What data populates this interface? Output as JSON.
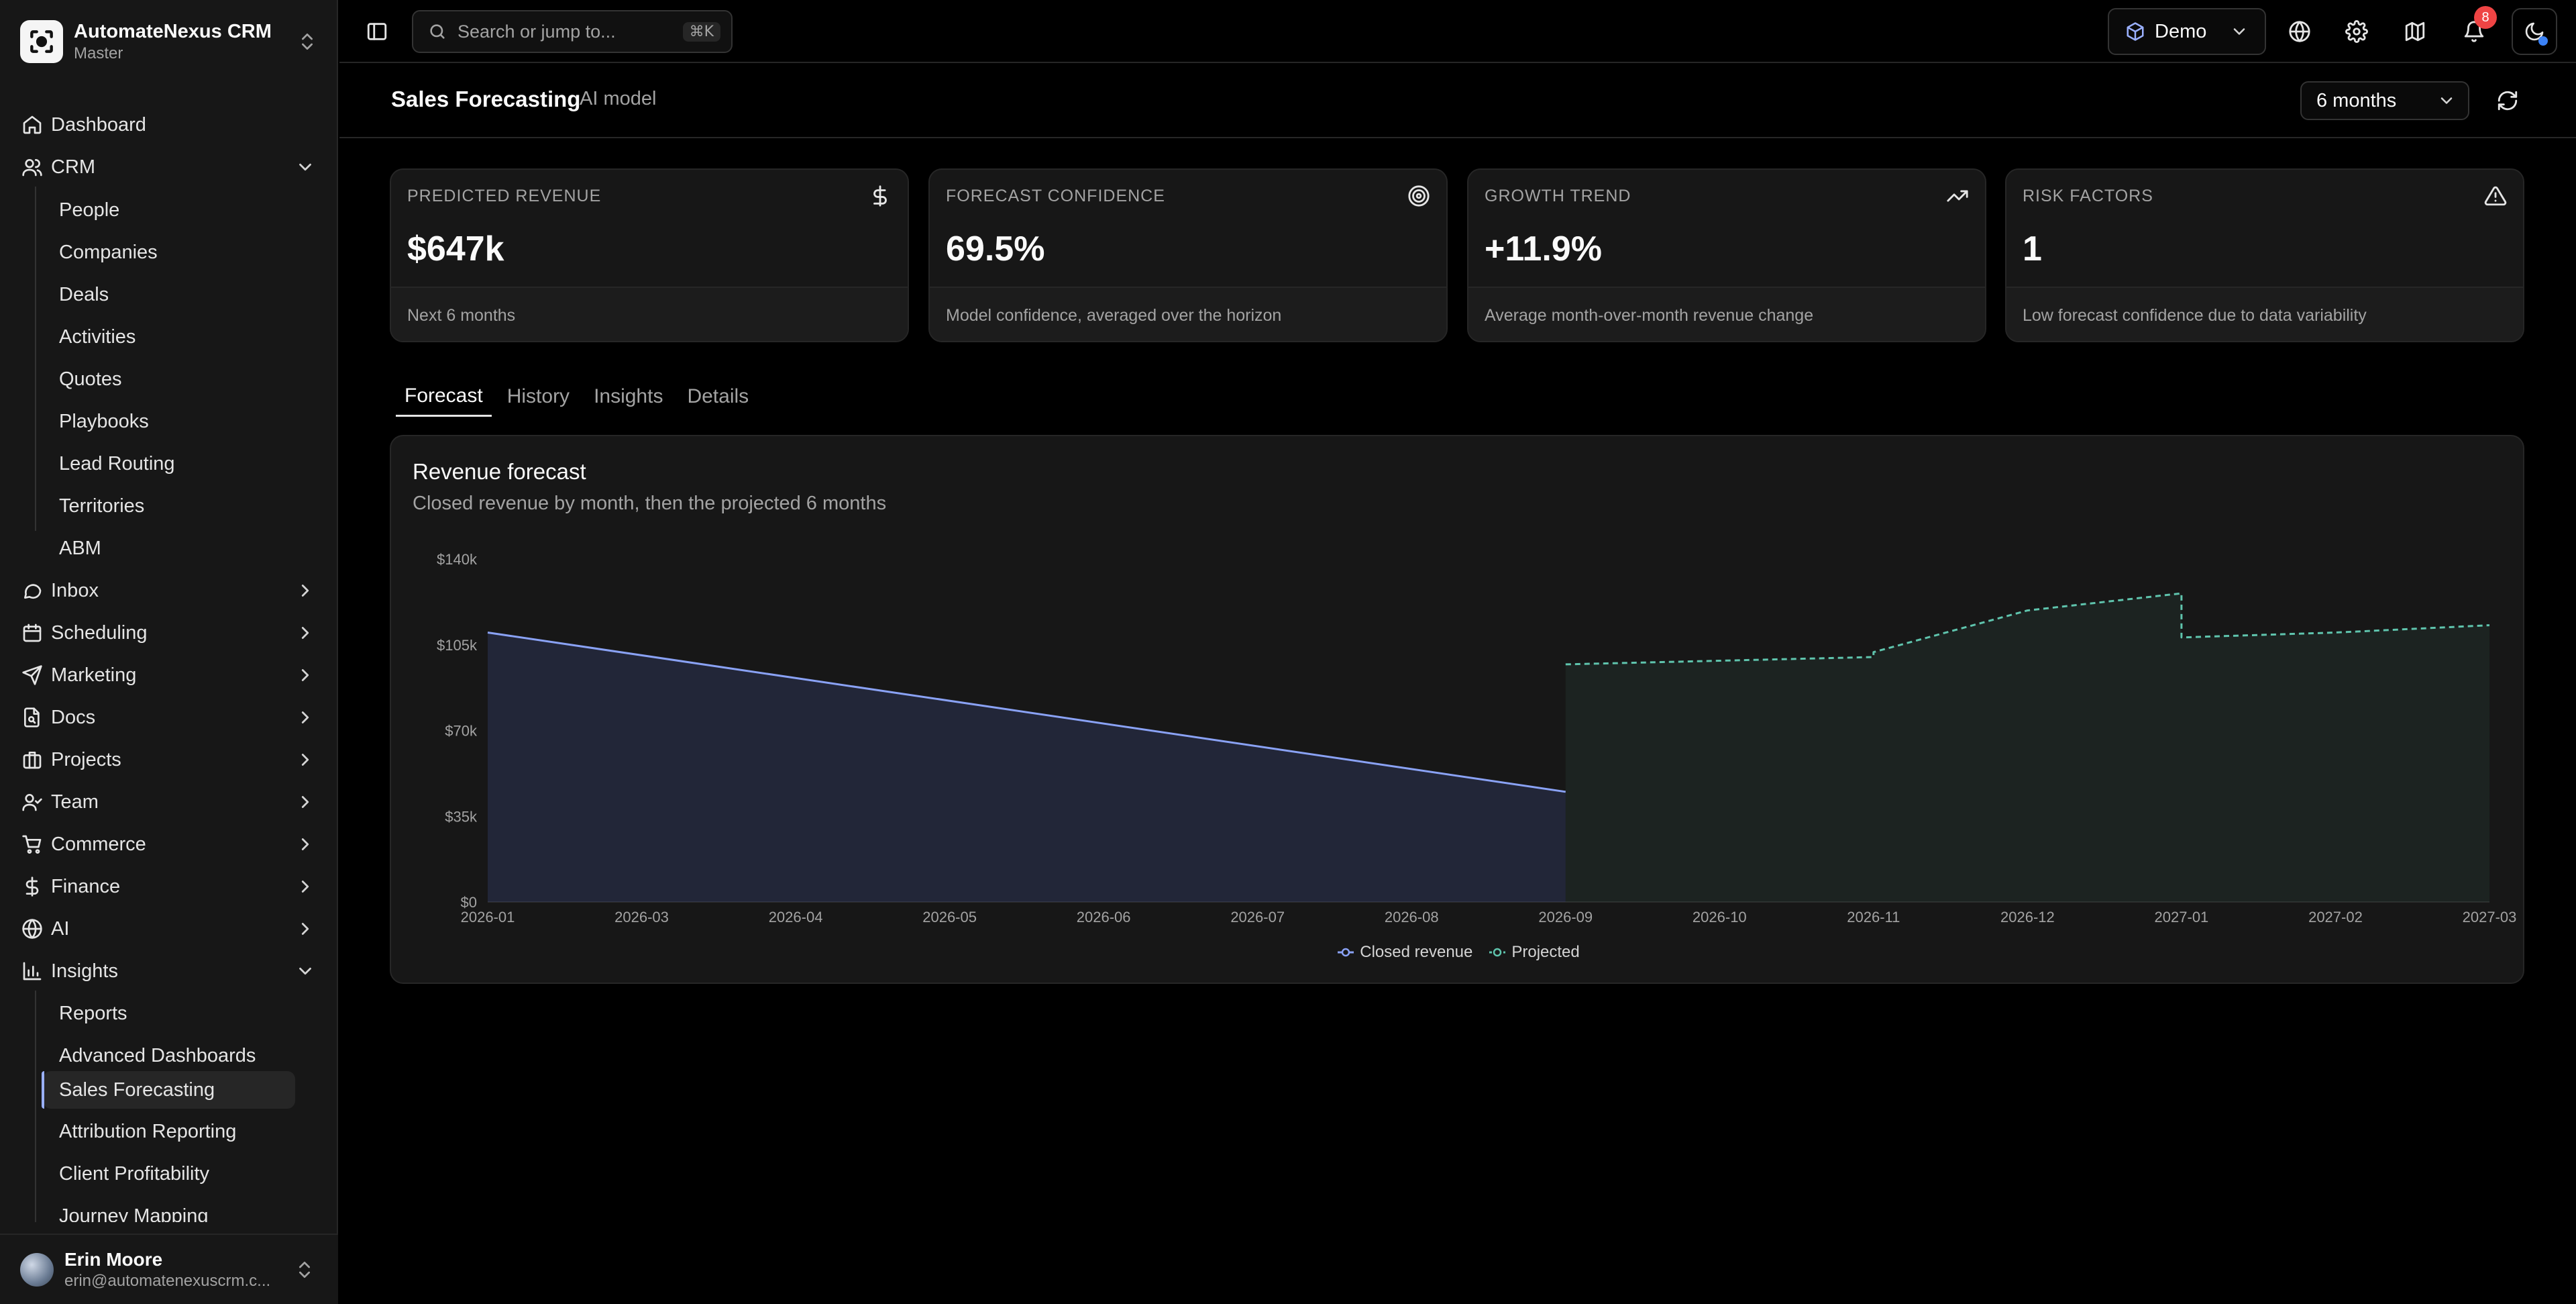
{
  "app": {
    "name": "AutomateNexus CRM",
    "workspace": "Master"
  },
  "sidebar": {
    "items": [
      {
        "label": "Dashboard",
        "icon": "home-icon"
      },
      {
        "label": "CRM",
        "icon": "users-icon",
        "expanded": true,
        "children": [
          "People",
          "Companies",
          "Deals",
          "Activities",
          "Quotes",
          "Playbooks",
          "Lead Routing",
          "Territories",
          "ABM"
        ]
      },
      {
        "label": "Inbox",
        "icon": "message-circle-icon"
      },
      {
        "label": "Scheduling",
        "icon": "calendar-icon"
      },
      {
        "label": "Marketing",
        "icon": "send-icon"
      },
      {
        "label": "Docs",
        "icon": "document-icon"
      },
      {
        "label": "Projects",
        "icon": "briefcase-icon"
      },
      {
        "label": "Team",
        "icon": "team-icon"
      },
      {
        "label": "Commerce",
        "icon": "cart-icon"
      },
      {
        "label": "Finance",
        "icon": "dollar-icon"
      },
      {
        "label": "AI",
        "icon": "globe-icon"
      },
      {
        "label": "Insights",
        "icon": "bar-chart-icon",
        "expanded": true,
        "children": [
          "Reports",
          "Advanced Dashboards",
          "Sales Forecasting",
          "Attribution Reporting",
          "Client Profitability",
          "Journey Mapping"
        ],
        "active_child": "Sales Forecasting"
      }
    ]
  },
  "user": {
    "name": "Erin Moore",
    "email": "erin@automatenexuscrm.c..."
  },
  "topbar": {
    "search_placeholder": "Search or jump to...",
    "search_shortcut": "⌘K",
    "workspace_button": "Demo",
    "notification_count": "8"
  },
  "page": {
    "title": "Sales Forecasting",
    "subtitle": "AI model",
    "period": "6 months"
  },
  "kpis": [
    {
      "label": "PREDICTED REVENUE",
      "value": "$647k",
      "foot": "Next 6 months",
      "icon": "dollar-icon"
    },
    {
      "label": "FORECAST CONFIDENCE",
      "value": "69.5%",
      "foot": "Model confidence, averaged over the horizon",
      "icon": "target-icon"
    },
    {
      "label": "GROWTH TREND",
      "value": "+11.9%",
      "foot": "Average month-over-month revenue change",
      "icon": "trending-up-icon"
    },
    {
      "label": "RISK FACTORS",
      "value": "1",
      "foot": "Low forecast confidence due to data variability",
      "icon": "alert-triangle-icon"
    }
  ],
  "tabs": [
    "Forecast",
    "History",
    "Insights",
    "Details"
  ],
  "active_tab": "Forecast",
  "chart": {
    "title": "Revenue forecast",
    "subtitle": "Closed revenue by month, then the projected 6 months"
  },
  "colors": {
    "closed": "#8aa2f5",
    "projected": "#5fc4ad",
    "badge": "#ef4444"
  },
  "chart_data": {
    "type": "area",
    "x": [
      "2026-01",
      "2026-03",
      "2026-04",
      "2026-05",
      "2026-06",
      "2026-07",
      "2026-08",
      "2026-09",
      "2026-10",
      "2026-11",
      "2026-12",
      "2027-01",
      "2027-02",
      "2027-03"
    ],
    "ylim": [
      0,
      140000
    ],
    "yticks": [
      "$0",
      "$35k",
      "$70k",
      "$105k",
      "$140k"
    ],
    "series": [
      {
        "name": "Closed revenue",
        "style": "solid",
        "points": [
          [
            "2026-01",
            110000
          ],
          [
            "2026-09",
            45000
          ]
        ]
      },
      {
        "name": "Projected",
        "style": "dashed",
        "points": [
          [
            "2026-09",
            97000
          ],
          [
            "2026-10",
            98500
          ],
          [
            "2026-11",
            100000
          ],
          [
            "2026-11",
            102000
          ],
          [
            "2026-12",
            119000
          ],
          [
            "2027-01",
            126000
          ],
          [
            "2027-01",
            108000
          ],
          [
            "2027-02",
            110000
          ],
          [
            "2027-03",
            113000
          ]
        ]
      }
    ],
    "legend": "bottom-center",
    "grid": false
  }
}
